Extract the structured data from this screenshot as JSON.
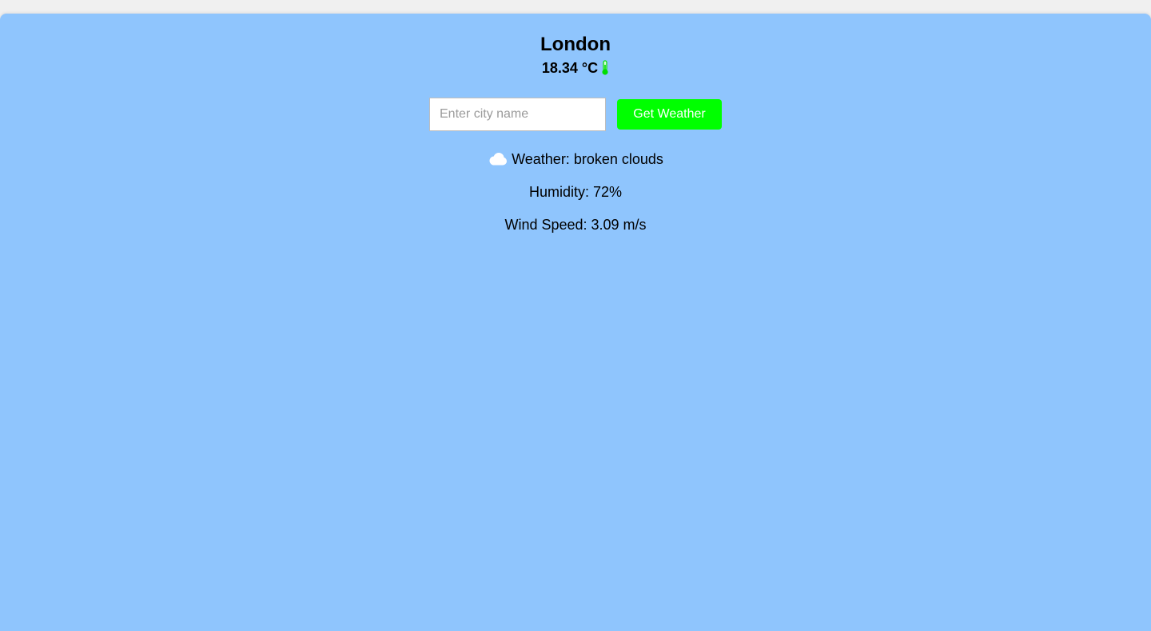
{
  "weather": {
    "city": "London",
    "temperature": "18.34 °C",
    "thermometer_icon": "thermometer-icon",
    "description_prefix": "Weather:",
    "description": "broken clouds",
    "condition_icon": "cloud-icon",
    "humidity_label": "Humidity:",
    "humidity": "72%",
    "wind_label": "Wind Speed:",
    "wind_speed": "3.09 m/s"
  },
  "search": {
    "placeholder": "Enter city name",
    "value": "",
    "button_label": "Get Weather"
  },
  "colors": {
    "panel_background": "#8fc5fd",
    "button_background": "#00ff00",
    "button_text": "#ffffff",
    "thermometer": "#00dd00",
    "cloud": "#ffffff"
  }
}
